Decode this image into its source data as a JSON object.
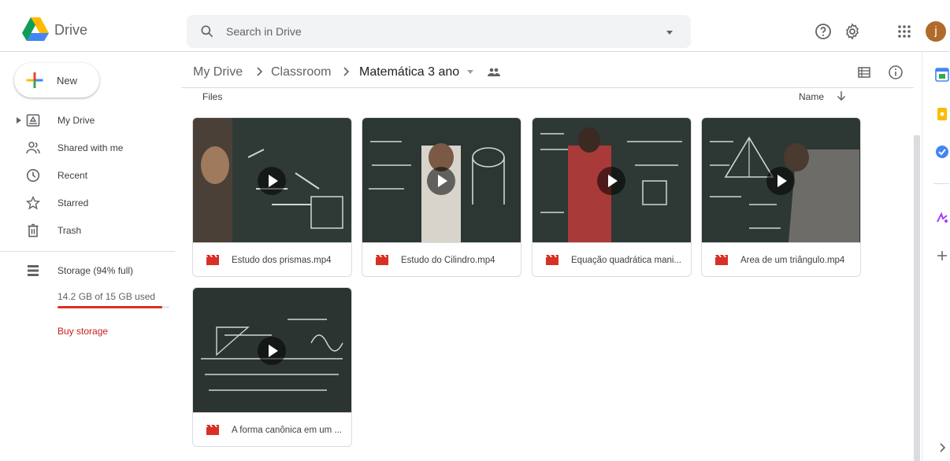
{
  "app": {
    "name": "Drive",
    "avatar_letter": "j"
  },
  "search": {
    "placeholder": "Search in Drive"
  },
  "sidebar": {
    "new_label": "New",
    "items": [
      {
        "label": "My Drive",
        "icon": "my-drive-icon"
      },
      {
        "label": "Shared with me",
        "icon": "shared-icon"
      },
      {
        "label": "Recent",
        "icon": "clock-icon"
      },
      {
        "label": "Starred",
        "icon": "star-icon"
      },
      {
        "label": "Trash",
        "icon": "trash-icon"
      }
    ],
    "storage": {
      "label": "Storage (94% full)",
      "usage_text": "14.2 GB of 15 GB used",
      "percent_used": 94,
      "buy_label": "Buy storage"
    }
  },
  "breadcrumb": {
    "items": [
      "My Drive",
      "Classroom",
      "Matemática 3 ano"
    ]
  },
  "content": {
    "section_label": "Files",
    "sort_label": "Name",
    "files": [
      {
        "name": "Estudo dos prismas.mp4"
      },
      {
        "name": "Estudo do Cilindro.mp4"
      },
      {
        "name": "Equação quadrática mani..."
      },
      {
        "name": "Área de um triângulo.mp4"
      },
      {
        "name": "A forma canônica em um ..."
      }
    ]
  },
  "colors": {
    "accent_red": "#d93025",
    "video_icon": "#d93025",
    "chalkboard": "#2f3a36"
  }
}
